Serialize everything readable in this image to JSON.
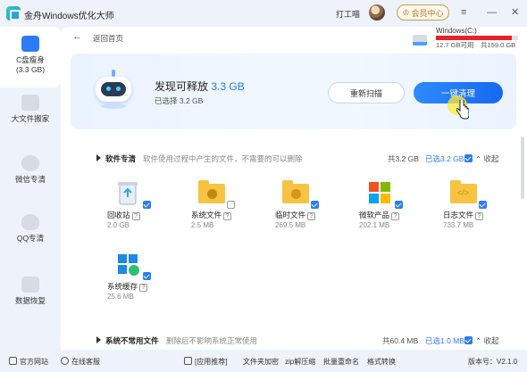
{
  "app": {
    "title": "金舟Windows优化大师",
    "user": "打工喵",
    "vip_label": "会员中心",
    "vip_icon": "crown-icon"
  },
  "window_controls": {
    "menu": "≡",
    "minimize": "—",
    "close": "✕"
  },
  "sidebar": {
    "items": [
      {
        "label": "C盘瘦身",
        "sub": "(3.3 GB)",
        "icon": "disk-icon",
        "active": true
      },
      {
        "label": "大文件搬家",
        "icon": "box-icon"
      },
      {
        "label": "微信专清",
        "icon": "wechat-icon"
      },
      {
        "label": "QQ专清",
        "icon": "qq-icon"
      },
      {
        "label": "数据恢复",
        "icon": "restore-icon"
      }
    ]
  },
  "header": {
    "back_label": "返回首页",
    "disk_name": "Windows(C:)",
    "disk_used": "12.7 GB可用",
    "disk_total": "共159.0 GB",
    "disk_used_fraction": 0.92,
    "disk_bar_color": "#e8202a"
  },
  "banner": {
    "found_prefix": "发现可释放",
    "found_size": "3.3 GB",
    "selected": "已选择 3.2 GB",
    "rescan_label": "重新扫描",
    "clean_label": "一键清理"
  },
  "sections": [
    {
      "title": "软件专清",
      "desc": "软件使用过程中产生的文件，不需要的可以删除",
      "total": "共3.2 GB",
      "selected": "已选3.2 GB",
      "collapse": "收起",
      "items": [
        {
          "name": "回收站",
          "size": "2.0 GB",
          "icon": "recycle-bin-icon",
          "checked": true
        },
        {
          "name": "系统文件",
          "size": "2.5 MB",
          "icon": "system-folder-icon",
          "checked": false
        },
        {
          "name": "临时文件",
          "size": "269.5 MB",
          "icon": "temp-folder-icon",
          "checked": true
        },
        {
          "name": "微软产品",
          "size": "202.1 MB",
          "icon": "microsoft-icon",
          "checked": true
        },
        {
          "name": "日志文件",
          "size": "733.7 MB",
          "icon": "log-folder-icon",
          "checked": true
        },
        {
          "name": "系统缓存",
          "size": "25.6 MB",
          "icon": "system-cache-icon",
          "checked": true
        }
      ]
    },
    {
      "title": "系统不常用文件",
      "desc": "删除后不影响系统正常使用",
      "total": "共60.4 MB",
      "selected": "已选1.0 MB",
      "collapse": "收起"
    }
  ],
  "footer": {
    "items": [
      "官方网站",
      "在线客服",
      "[应用推荐]",
      "文件夹加密",
      "zip解压缩",
      "批量重命名",
      "格式转换"
    ],
    "version": "版本号：V2.1.0"
  }
}
